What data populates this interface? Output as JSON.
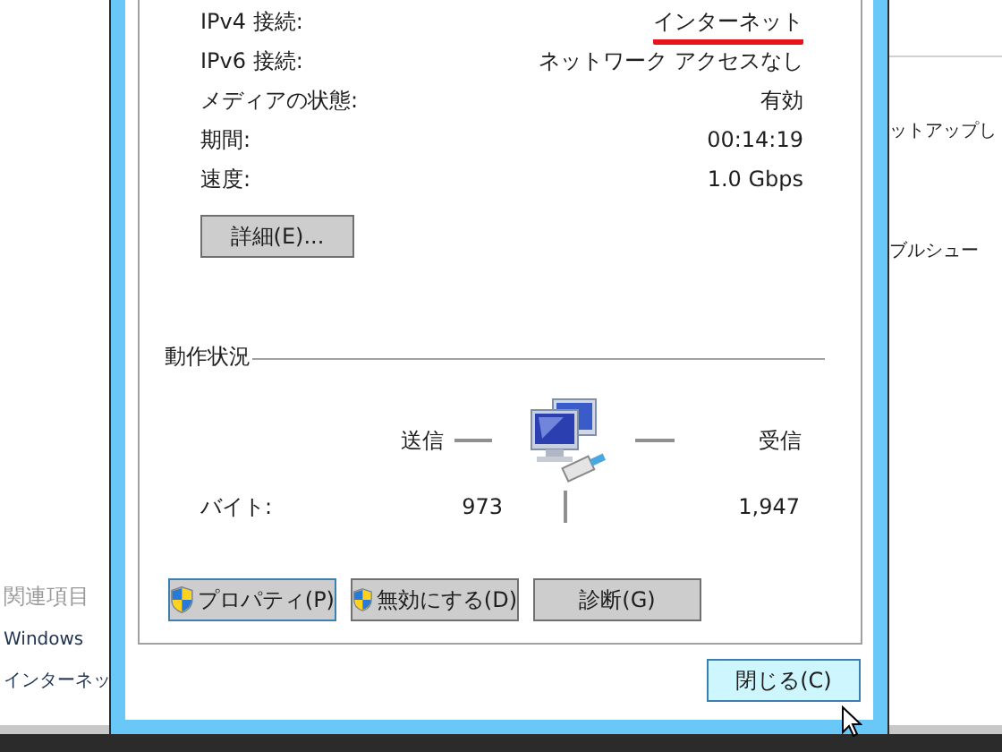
{
  "background_window": {
    "right_texts": [
      "ットアップし",
      "ブルシュー"
    ],
    "related_heading": "関連項目",
    "related_links": [
      "Windows",
      "インターネッ"
    ]
  },
  "connection_rows": [
    {
      "label": "IPv4 接続:",
      "value": "インターネット",
      "highlighted": true
    },
    {
      "label": "IPv6 接続:",
      "value": "ネットワーク アクセスなし",
      "highlighted": false
    },
    {
      "label": "メディアの状態:",
      "value": "有効",
      "highlighted": false
    },
    {
      "label": "期間:",
      "value": "00:14:19",
      "highlighted": false
    },
    {
      "label": "速度:",
      "value": "1.0 Gbps",
      "highlighted": false
    }
  ],
  "details_button": "詳細(E)...",
  "activity": {
    "title": "動作状況",
    "sent_label": "送信",
    "received_label": "受信",
    "bytes_label": "バイト:",
    "bytes_sent": "973",
    "bytes_received": "1,947"
  },
  "buttons": [
    {
      "label": "プロパティ(P)",
      "shield": true,
      "focused": true
    },
    {
      "label": "無効にする(D)",
      "shield": true,
      "focused": false
    },
    {
      "label": "診断(G)",
      "shield": false,
      "focused": false
    }
  ],
  "close_button": {
    "label": "閉じる(C)",
    "hovered": true
  }
}
